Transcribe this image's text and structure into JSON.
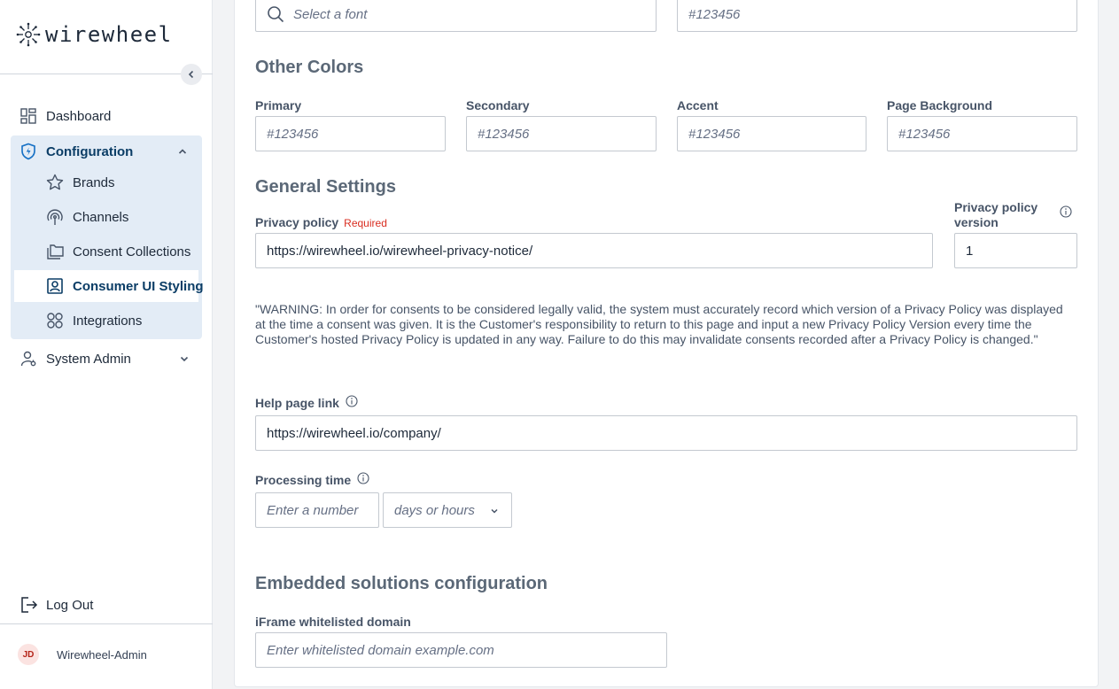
{
  "brand": {
    "name": "wirewheel"
  },
  "sidebar": {
    "dashboard": "Dashboard",
    "configuration": "Configuration",
    "sub_items": [
      {
        "label": "Brands",
        "icon": "star-icon"
      },
      {
        "label": "Channels",
        "icon": "broadcast-icon"
      },
      {
        "label": "Consent Collections",
        "icon": "folders-icon"
      },
      {
        "label": "Consumer UI Styling",
        "icon": "user-frame-icon",
        "active": true
      },
      {
        "label": "Integrations",
        "icon": "grid-circles-icon"
      }
    ],
    "system_admin": "System Admin",
    "logout": "Log Out",
    "user_initials": "JD",
    "user_name": "Wirewheel-Admin"
  },
  "form": {
    "font_placeholder": "Select a font",
    "top_color_placeholder": "#123456",
    "other_colors": {
      "title": "Other Colors",
      "fields": [
        {
          "label": "Primary",
          "placeholder": "#123456"
        },
        {
          "label": "Secondary",
          "placeholder": "#123456"
        },
        {
          "label": "Accent",
          "placeholder": "#123456"
        },
        {
          "label": "Page Background",
          "placeholder": "#123456"
        }
      ]
    },
    "general": {
      "title": "General Settings",
      "privacy_label": "Privacy policy",
      "required": "Required",
      "privacy_value": "https://wirewheel.io/wirewheel-privacy-notice/",
      "version_label_line1": "Privacy policy",
      "version_label_line2": "version",
      "version_value": "1",
      "warning": "\"WARNING: In order for consents to be considered legally valid, the system must accurately record which version of a Privacy Policy was displayed at the time a consent was given. It is the Customer's responsibility to return to this page and input a new Privacy Policy Version every time the Customer's hosted Privacy Policy is updated in any way. Failure to do this may invalidate consents recorded after a Privacy Policy is changed.\"",
      "help_label": "Help page link",
      "help_value": "https://wirewheel.io/company/",
      "processing_label": "Processing time",
      "processing_placeholder": "Enter a number",
      "processing_unit": "days or hours"
    },
    "embedded": {
      "title": "Embedded solutions configuration",
      "iframe_label": "iFrame whitelisted domain",
      "iframe_placeholder": "Enter whitelisted domain example.com"
    }
  },
  "colors": {
    "accent": "#0b3d66",
    "active_bg": "#e3ecf6",
    "required": "#d92d20"
  }
}
